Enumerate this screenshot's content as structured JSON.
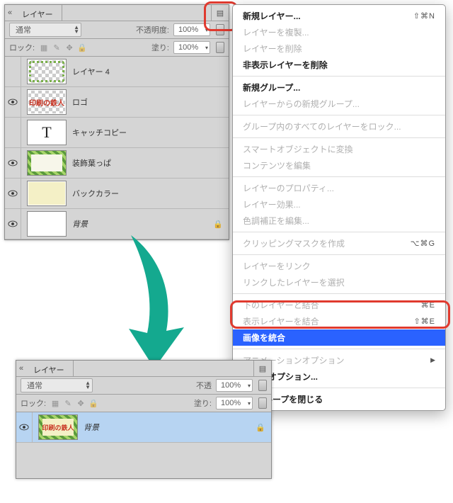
{
  "panel1": {
    "title": "レイヤー",
    "blend_mode": "通常",
    "opacity_label": "不透明度:",
    "opacity_value": "100%",
    "lock_label": "ロック:",
    "fill_label": "塗り:",
    "fill_value": "100%",
    "layers": [
      {
        "name": "レイヤー 4",
        "italic": false,
        "visible": false,
        "thumb": "checker fancy-border"
      },
      {
        "name": "ロゴ",
        "italic": false,
        "visible": true,
        "thumb": "checker logo",
        "logo": "印刷の鉄人"
      },
      {
        "name": "キャッチコピー",
        "italic": false,
        "visible": false,
        "thumb": "typeT",
        "glyph": "T"
      },
      {
        "name": "装飾葉っぱ",
        "italic": false,
        "visible": true,
        "thumb": "leaf-border checker"
      },
      {
        "name": "バックカラー",
        "italic": false,
        "visible": true,
        "thumb": "solidcream"
      },
      {
        "name": "背景",
        "italic": true,
        "visible": true,
        "thumb": "white",
        "locked": true
      }
    ]
  },
  "panel2": {
    "title": "レイヤー",
    "blend_mode": "通常",
    "opacity_label": "不透",
    "opacity_value": "100%",
    "lock_label": "ロック:",
    "fill_label": "塗り:",
    "fill_value": "100%",
    "layer": {
      "name": "背景",
      "italic": true,
      "locked": true,
      "logo": "印刷の鉄人"
    }
  },
  "menu": {
    "items": [
      {
        "label": "新規レイヤー...",
        "bold": true,
        "shortcut": "⇧⌘N"
      },
      {
        "label": "レイヤーを複製...",
        "disabled": true
      },
      {
        "label": "レイヤーを削除",
        "disabled": true
      },
      {
        "label": "非表示レイヤーを削除",
        "bold": true
      },
      {
        "sep": true
      },
      {
        "label": "新規グループ...",
        "bold": true
      },
      {
        "label": "レイヤーからの新規グループ...",
        "disabled": true
      },
      {
        "sep": true
      },
      {
        "label": "グループ内のすべてのレイヤーをロック...",
        "disabled": true
      },
      {
        "sep": true
      },
      {
        "label": "スマートオブジェクトに変換",
        "disabled": true
      },
      {
        "label": "コンテンツを編集",
        "disabled": true
      },
      {
        "sep": true
      },
      {
        "label": "レイヤーのプロパティ...",
        "disabled": true
      },
      {
        "label": "レイヤー効果...",
        "disabled": true
      },
      {
        "label": "色調補正を編集...",
        "disabled": true
      },
      {
        "sep": true
      },
      {
        "label": "クリッピングマスクを作成",
        "disabled": true,
        "shortcut": "⌥⌘G"
      },
      {
        "sep": true
      },
      {
        "label": "レイヤーをリンク",
        "disabled": true
      },
      {
        "label": "リンクしたレイヤーを選択",
        "disabled": true
      },
      {
        "sep": true
      },
      {
        "label": "下のレイヤーと結合",
        "disabled": true,
        "shortcut": "⌘E"
      },
      {
        "label": "表示レイヤーを結合",
        "disabled": true,
        "shortcut": "⇧⌘E"
      },
      {
        "label": "画像を統合",
        "bold": true,
        "highlight": true
      },
      {
        "sep": true
      },
      {
        "label": "アニメーションオプション",
        "disabled": true,
        "submenu": true
      },
      {
        "label": "パネルオプション...",
        "bold": true
      },
      {
        "sep": true
      },
      {
        "label": "ループを閉じる",
        "bold": true,
        "cut": "left"
      }
    ]
  }
}
